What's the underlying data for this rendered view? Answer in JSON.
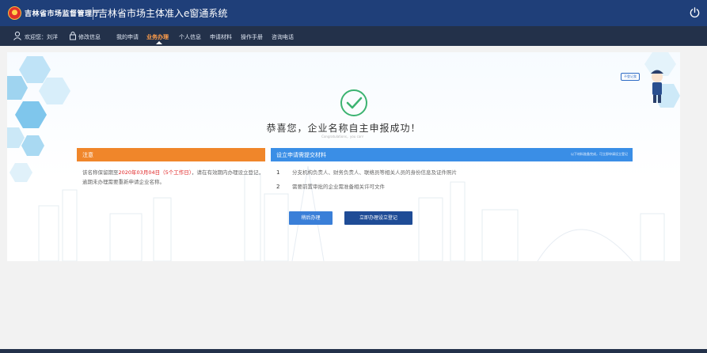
{
  "header": {
    "org_name": "吉林省市场监督管理厅",
    "system_title": "吉林省市场主体准入e窗通系统"
  },
  "nav": {
    "welcome": "欢迎您：刘洋",
    "edit_info": "修改信息",
    "items": [
      {
        "label": "我的申请"
      },
      {
        "label": "业务办理",
        "active": true
      },
      {
        "label": "个人信息"
      },
      {
        "label": "申请材料"
      },
      {
        "label": "操作手册"
      },
      {
        "label": "咨询电话"
      }
    ]
  },
  "result": {
    "title": "恭喜您，企业名称自主申报成功！",
    "subtitle": "Congratulations，you can！"
  },
  "mascot": {
    "tag": "不登记我"
  },
  "notice": {
    "heading": "注意",
    "text_before": "该名称保留期至",
    "highlight": "2020年03月04日（5个工作日）",
    "text_after": "，请在有效期内办理设立登记，逾期未办理需要重新申请企业名称。"
  },
  "materials": {
    "heading": "设立申请需提交材料",
    "note": "以下材料准备完成，可立即申请设立登记",
    "items": [
      {
        "num": "1",
        "text": "分支机构负责人、财务负责人、联络员等相关人员的身份信息及证件照片"
      },
      {
        "num": "2",
        "text": "需要前置审批的企业需准备相关许可文件"
      }
    ]
  },
  "buttons": {
    "later": "稍后办理",
    "now": "立即办理设立登记"
  },
  "colors": {
    "header_bg": "#1f3f79",
    "nav_bg": "#23314a",
    "accent_orange": "#f0862a",
    "accent_blue": "#3a8ee6",
    "success_green": "#3cb371"
  }
}
